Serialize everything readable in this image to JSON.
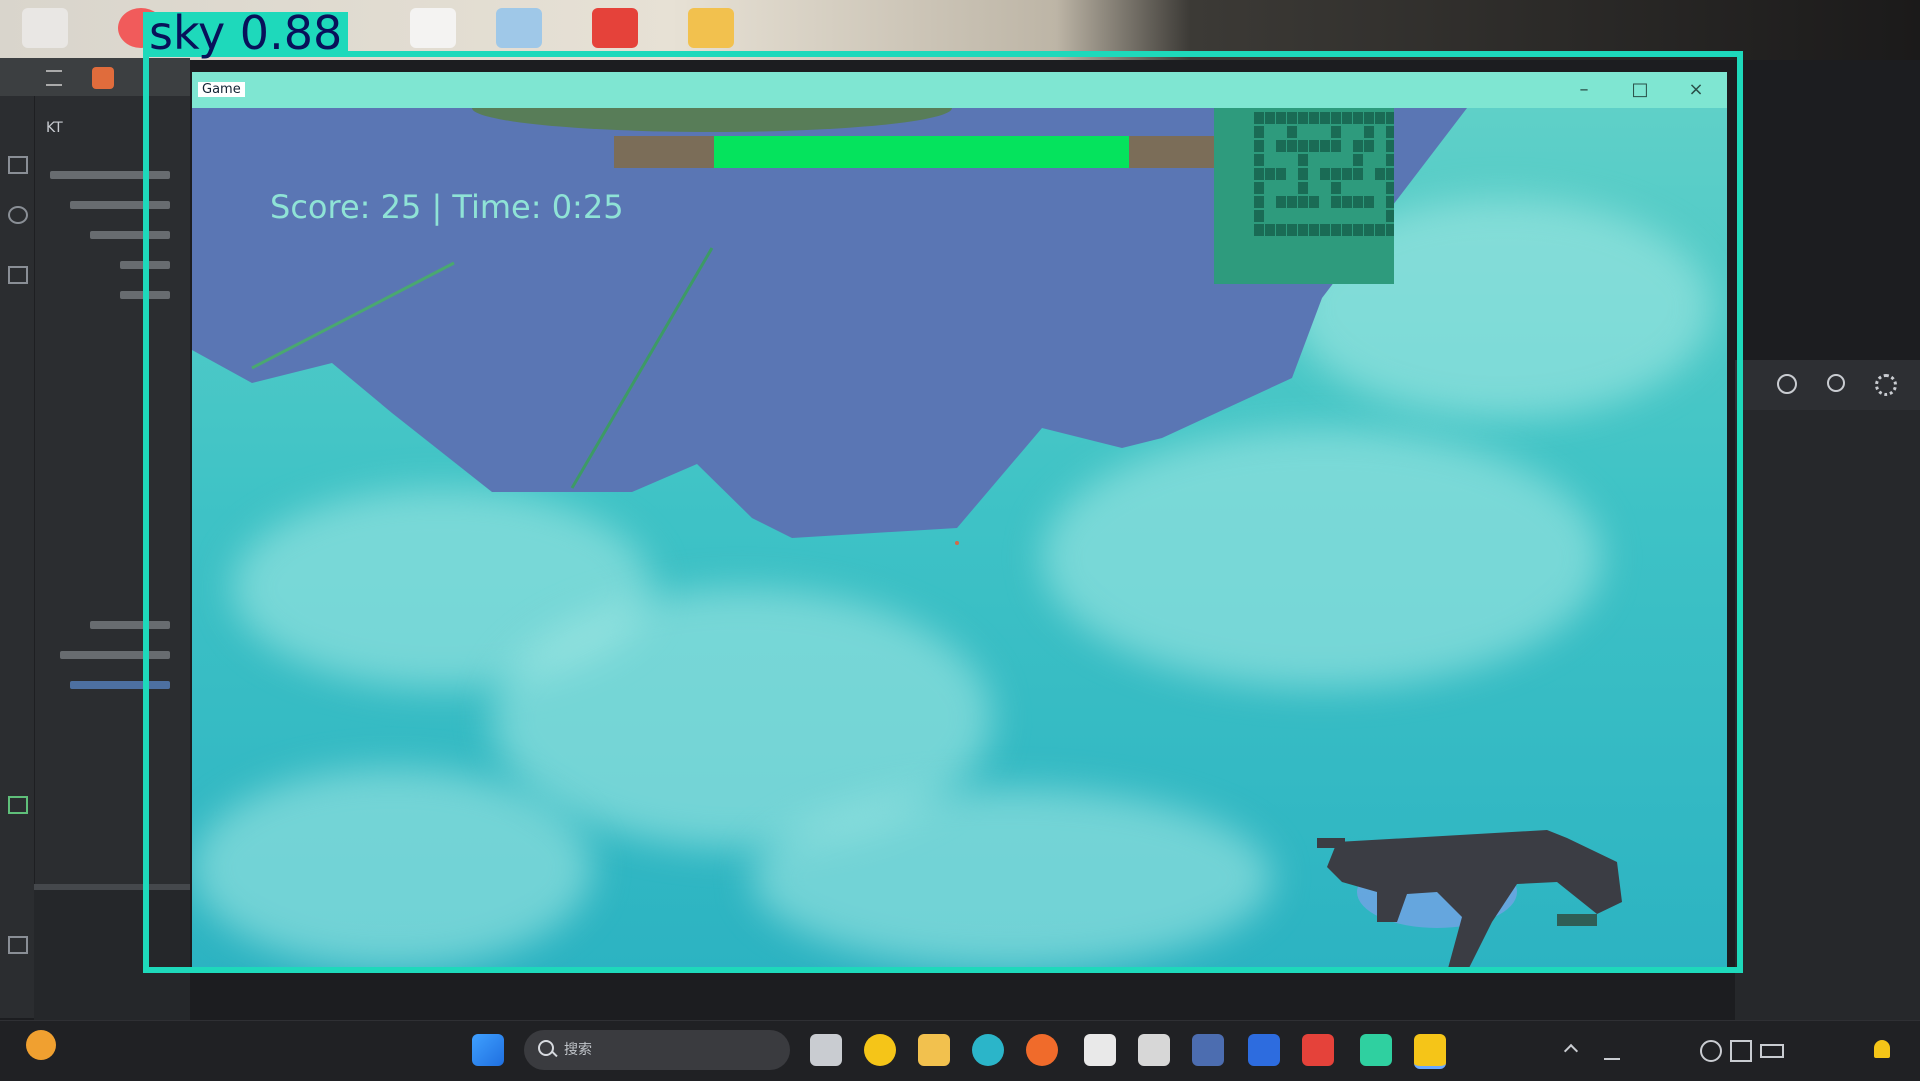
{
  "detection": {
    "label": "sky  0.88",
    "box_color": "#1ed9bb",
    "label_text_color": "#08115a"
  },
  "game": {
    "window_title": "Game",
    "hud_text": "Score: 25 | Time: 0:25",
    "health_fraction": 0.83,
    "health_color": "#05e35d",
    "sky_color": "#3fc3c6",
    "weapon_icon": "rifle-icon",
    "window_buttons": {
      "minimize": "–",
      "maximize": "□",
      "close": "×"
    }
  },
  "ide": {
    "toolbar_label": "KT"
  },
  "taskbar": {
    "search_placeholder": "搜索",
    "icons": [
      "start-icon",
      "search-icon",
      "task-view-icon",
      "lightning-icon",
      "folder-icon",
      "edge-icon",
      "firefox-icon",
      "store-icon",
      "app-icon",
      "remote-icon",
      "vscode-icon",
      "wps-icon",
      "pycharm-icon",
      "python-icon"
    ],
    "tray": [
      "chevron-up-icon",
      "ime-icon",
      "network-icon",
      "volume-icon",
      "battery-icon"
    ]
  }
}
